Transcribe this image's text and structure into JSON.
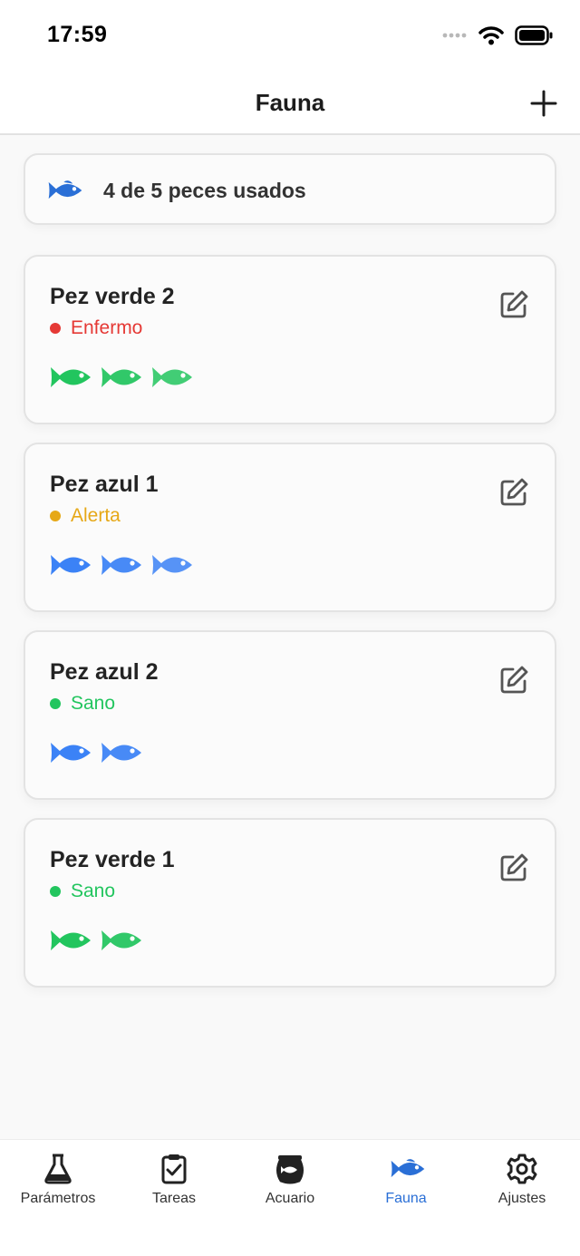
{
  "status": {
    "time": "17:59"
  },
  "header": {
    "title": "Fauna",
    "add_icon": "plus-icon"
  },
  "usage": {
    "text": "4 de 5 peces usados",
    "icon": "fish-icon",
    "color": "#2a6fd6"
  },
  "fish": [
    {
      "name": "Pez verde 2",
      "status": "Enfermo",
      "status_color": "#e53935",
      "fish_color": "green",
      "count": 3
    },
    {
      "name": "Pez azul 1",
      "status": "Alerta",
      "status_color": "#e6a817",
      "fish_color": "blue",
      "count": 3
    },
    {
      "name": "Pez azul 2",
      "status": "Sano",
      "status_color": "#22c55e",
      "fish_color": "blue",
      "count": 2
    },
    {
      "name": "Pez verde 1",
      "status": "Sano",
      "status_color": "#22c55e",
      "fish_color": "green",
      "count": 2
    }
  ],
  "colors": {
    "green_fish": "#22c55e",
    "blue_fish": "#3b82f6",
    "accent": "#2a6fd6"
  },
  "tabs": [
    {
      "label": "Parámetros",
      "icon": "flask-icon",
      "active": false
    },
    {
      "label": "Tareas",
      "icon": "clipboard-check-icon",
      "active": false
    },
    {
      "label": "Acuario",
      "icon": "aquarium-icon",
      "active": false
    },
    {
      "label": "Fauna",
      "icon": "fish-icon",
      "active": true
    },
    {
      "label": "Ajustes",
      "icon": "gear-icon",
      "active": false
    }
  ]
}
